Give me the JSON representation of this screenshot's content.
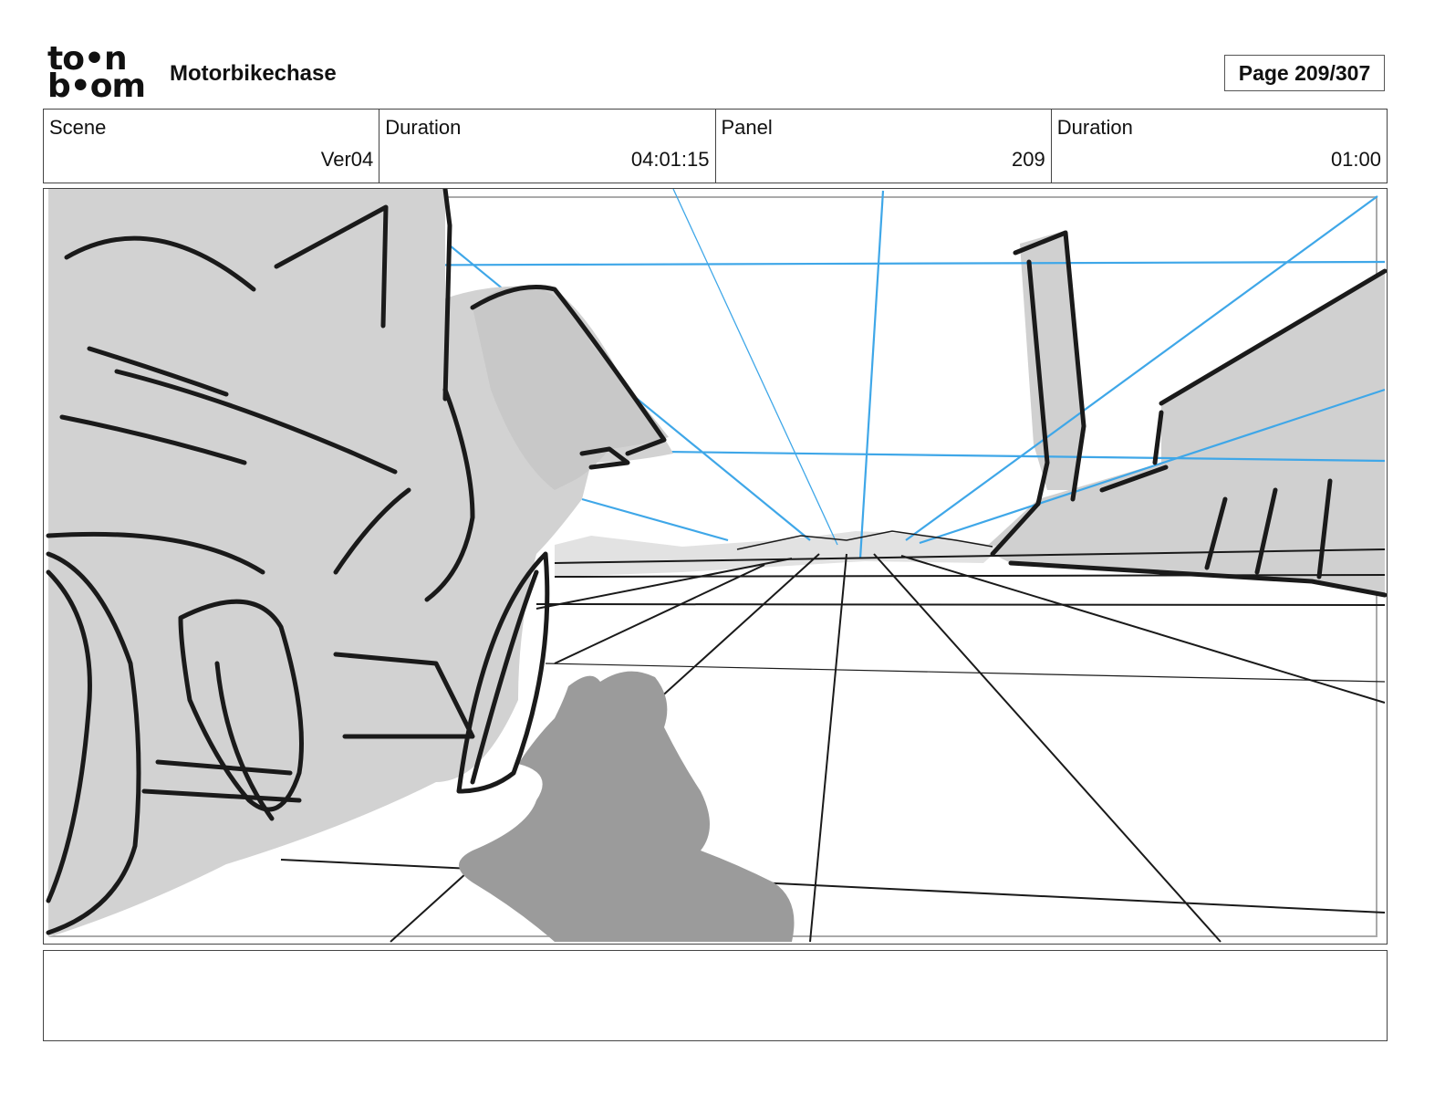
{
  "header": {
    "logo_top": "to•n",
    "logo_bottom": "b•om",
    "project_title": "Motorbikechase",
    "page_label": "Page 209/307"
  },
  "info": {
    "scene_label": "Scene",
    "scene_value": "Ver04",
    "scene_duration_label": "Duration",
    "scene_duration_value": "04:01:15",
    "panel_label": "Panel",
    "panel_value": "209",
    "panel_duration_label": "Duration",
    "panel_duration_value": "01:00"
  },
  "colors": {
    "guide_blue": "#3fa7e8",
    "sketch_ink": "#1a1a1a",
    "fill_gray": "#d0d0d0",
    "shadow_gray": "#9b9b9b"
  }
}
